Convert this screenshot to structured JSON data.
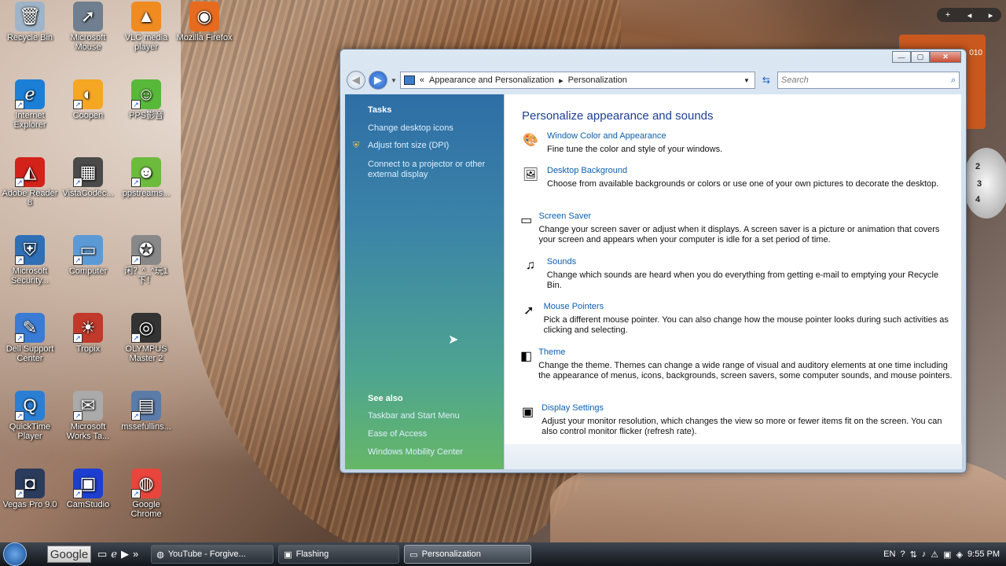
{
  "desktop_icons": [
    {
      "label": "Recycle Bin",
      "glyph": "🗑"
    },
    {
      "label": "Microsoft Mouse",
      "glyph": "➚"
    },
    {
      "label": "VLC media player",
      "glyph": "▲"
    },
    {
      "label": "Mozilla Firefox",
      "glyph": "◉"
    },
    {
      "label": "Internet Explorer",
      "glyph": "ℯ"
    },
    {
      "label": "Coopen",
      "glyph": "◐"
    },
    {
      "label": "PPS影音",
      "glyph": "☺"
    },
    {
      "label": "Adobe Reader 8",
      "glyph": "◭"
    },
    {
      "label": "VistaCodec...",
      "glyph": "▦"
    },
    {
      "label": "ppstreams...",
      "glyph": "☻"
    },
    {
      "label": "Microsoft Security...",
      "glyph": "⛨"
    },
    {
      "label": "Computer",
      "glyph": "▭"
    },
    {
      "label": "闲？^_^玩1下！",
      "glyph": "✪"
    },
    {
      "label": "Dell Support Center",
      "glyph": "✎"
    },
    {
      "label": "Tropix",
      "glyph": "☀"
    },
    {
      "label": "OLYMPUS Master 2",
      "glyph": "◎"
    },
    {
      "label": "QuickTime Player",
      "glyph": "Q"
    },
    {
      "label": "Microsoft Works Ta...",
      "glyph": "✉"
    },
    {
      "label": "mssefullins...",
      "glyph": "▤"
    },
    {
      "label": "Vegas Pro 9.0",
      "glyph": "◘"
    },
    {
      "label": "CamStudio",
      "glyph": "▣"
    },
    {
      "label": "Google Chrome",
      "glyph": "◍"
    }
  ],
  "window": {
    "title": "Personalization",
    "breadcrumb": [
      "Appearance and Personalization",
      "Personalization"
    ],
    "search_placeholder": "Search",
    "controls": {
      "minimize": "—",
      "maximize": "▢",
      "close": "✕"
    }
  },
  "left_pane": {
    "tasks_heading": "Tasks",
    "tasks": [
      "Change desktop icons",
      "Adjust font size (DPI)",
      "Connect to a projector or other external display"
    ],
    "see_also_heading": "See also",
    "see_also": [
      "Taskbar and Start Menu",
      "Ease of Access",
      "Windows Mobility Center"
    ]
  },
  "main": {
    "title": "Personalize appearance and sounds",
    "items": [
      {
        "title": "Window Color and Appearance",
        "desc": "Fine tune the color and style of your windows.",
        "icon": "window-color-icon"
      },
      {
        "title": "Desktop Background",
        "desc": "Choose from available backgrounds or colors or use one of your own pictures to decorate the desktop.",
        "icon": "desktop-background-icon"
      },
      {
        "title": "Screen Saver",
        "desc": "Change your screen saver or adjust when it displays. A screen saver is a picture or animation that covers your screen and appears when your computer is idle for a set period of time.",
        "icon": "screen-saver-icon"
      },
      {
        "title": "Sounds",
        "desc": "Change which sounds are heard when you do everything from getting e-mail to emptying your Recycle Bin.",
        "icon": "sounds-icon"
      },
      {
        "title": "Mouse Pointers",
        "desc": "Pick a different mouse pointer. You can also change how the mouse pointer looks during such activities as clicking and selecting.",
        "icon": "mouse-pointer-icon"
      },
      {
        "title": "Theme",
        "desc": "Change the theme. Themes can change a wide range of visual and auditory elements at one time including the appearance of menus, icons, backgrounds, screen savers, some computer sounds, and mouse pointers.",
        "icon": "theme-icon"
      },
      {
        "title": "Display Settings",
        "desc": "Adjust your monitor resolution, which changes the view so more or fewer items fit on the screen. You can also control monitor flicker (refresh rate).",
        "icon": "display-settings-icon"
      }
    ]
  },
  "gadgets": {
    "calendar_year": "010",
    "clock_numbers": [
      "2",
      "3",
      "4"
    ],
    "top_gadget": [
      "+",
      "◂",
      "▸"
    ]
  },
  "taskbar": {
    "search_label": "Google",
    "buttons": [
      {
        "label": "YouTube - Forgive...",
        "active": false
      },
      {
        "label": "Flashing",
        "active": false
      },
      {
        "label": "Personalization",
        "active": true
      }
    ],
    "language": "EN",
    "time": "9:55 PM"
  }
}
